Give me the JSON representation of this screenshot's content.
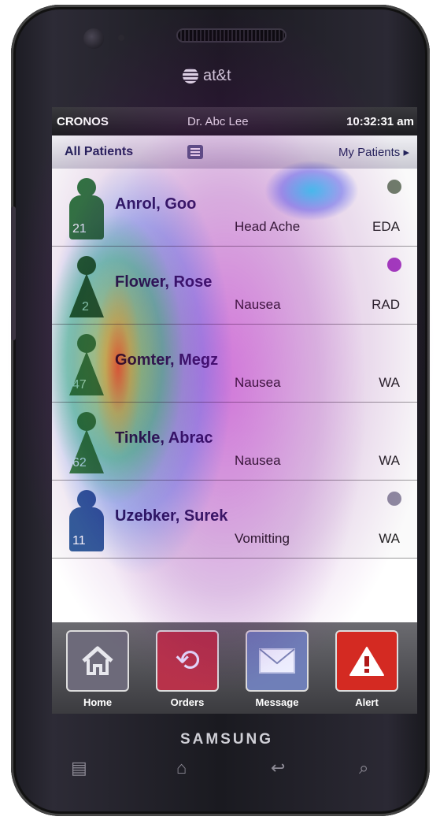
{
  "device": {
    "carrier": "at&t",
    "brand": "SAMSUNG"
  },
  "status": {
    "app_name": "CRONOS",
    "doctor": "Dr. Abc Lee",
    "time": "10:32:31 am"
  },
  "header": {
    "all_patients": "All Patients",
    "my_patients": "My Patients ▸"
  },
  "patients": [
    {
      "name": "Anrol, Goo",
      "complaint": "Head Ache",
      "dept": "EDA",
      "age": "21",
      "gender": "male",
      "color": "#2c7a3c",
      "dot_color": "#6f7d6a"
    },
    {
      "name": "Flower, Rose",
      "complaint": "Nausea",
      "dept": "RAD",
      "age": "2",
      "gender": "female",
      "color": "#1f6a2c",
      "dot_color": "#a53cc0"
    },
    {
      "name": "Gomter, Megz",
      "complaint": "Nausea",
      "dept": "WA",
      "age": "47",
      "gender": "female",
      "color": "#3a8a40",
      "dot_color": ""
    },
    {
      "name": "Tinkle, Abrac",
      "complaint": "Nausea",
      "dept": "WA",
      "age": "62",
      "gender": "female",
      "color": "#3a8a40",
      "dot_color": ""
    },
    {
      "name": "Uzebker, Surek",
      "complaint": "Vomitting",
      "dept": "WA",
      "age": "11",
      "gender": "male",
      "color": "#2f5f9a",
      "dot_color": "#8e8aa0"
    }
  ],
  "toolbar": {
    "home": "Home",
    "orders": "Orders",
    "message": "Message",
    "alert": "Alert"
  },
  "colors": {
    "home_button": "#6d6a7a",
    "orders_button": "#b8324a",
    "message_button": "#6f7fb8",
    "alert_button": "#d42a22"
  }
}
